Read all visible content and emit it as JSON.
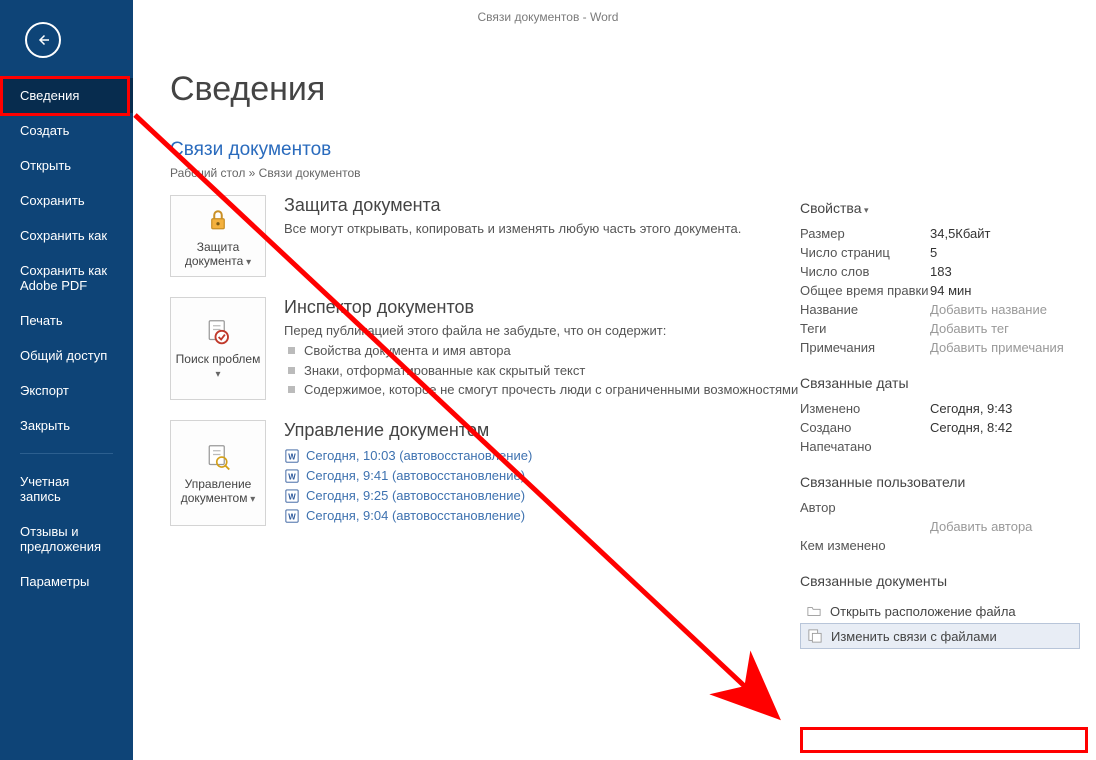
{
  "window_title": "Связи документов  -  Word",
  "sidebar": {
    "items": [
      "Сведения",
      "Создать",
      "Открыть",
      "Сохранить",
      "Сохранить как",
      "Сохранить как Adobe PDF",
      "Печать",
      "Общий доступ",
      "Экспорт",
      "Закрыть"
    ],
    "items2": [
      "Учетная запись",
      "Отзывы и предложения",
      "Параметры"
    ],
    "selected_index": 0
  },
  "page": {
    "title": "Сведения",
    "doc_name": "Связи документов",
    "breadcrumb": "Рабочий стол » Связи документов"
  },
  "buttons": {
    "protect": "Защита документа",
    "inspect": "Поиск проблем",
    "manage": "Управление документом"
  },
  "sections": {
    "protect": {
      "title": "Защита документа",
      "text": "Все могут открывать, копировать и изменять любую часть этого документа."
    },
    "inspect": {
      "title": "Инспектор документов",
      "lead": "Перед публикацией этого файла не забудьте, что он содержит:",
      "bullets": [
        "Свойства документа и имя автора",
        "Знаки, отформатированные как скрытый текст",
        "Содержимое, которое не смогут прочесть люди с ограниченными возможностями"
      ]
    },
    "manage": {
      "title": "Управление документом",
      "versions": [
        "Сегодня, 10:03 (автовосстановление)",
        "Сегодня, 9:41 (автовосстановление)",
        "Сегодня, 9:25 (автовосстановление)",
        "Сегодня, 9:04 (автовосстановление)"
      ]
    }
  },
  "properties": {
    "header": "Свойства",
    "rows": [
      {
        "label": "Размер",
        "value": "34,5Кбайт"
      },
      {
        "label": "Число страниц",
        "value": "5"
      },
      {
        "label": "Число слов",
        "value": "183"
      },
      {
        "label": "Общее время правки",
        "value": "94 мин"
      },
      {
        "label": "Название",
        "value": "Добавить название",
        "placeholder": true
      },
      {
        "label": "Теги",
        "value": "Добавить тег",
        "placeholder": true
      },
      {
        "label": "Примечания",
        "value": "Добавить примечания",
        "placeholder": true
      }
    ],
    "dates_header": "Связанные даты",
    "dates": [
      {
        "label": "Изменено",
        "value": "Сегодня, 9:43"
      },
      {
        "label": "Создано",
        "value": "Сегодня, 8:42"
      },
      {
        "label": "Напечатано",
        "value": ""
      }
    ],
    "people_header": "Связанные пользователи",
    "people": [
      {
        "label": "Автор",
        "value": ""
      },
      {
        "label": "",
        "value": "Добавить автора",
        "placeholder": true
      },
      {
        "label": "Кем изменено",
        "value": ""
      }
    ],
    "related_header": "Связанные документы",
    "related": {
      "open_location": "Открыть расположение файла",
      "edit_links": "Изменить связи с файлами"
    }
  }
}
